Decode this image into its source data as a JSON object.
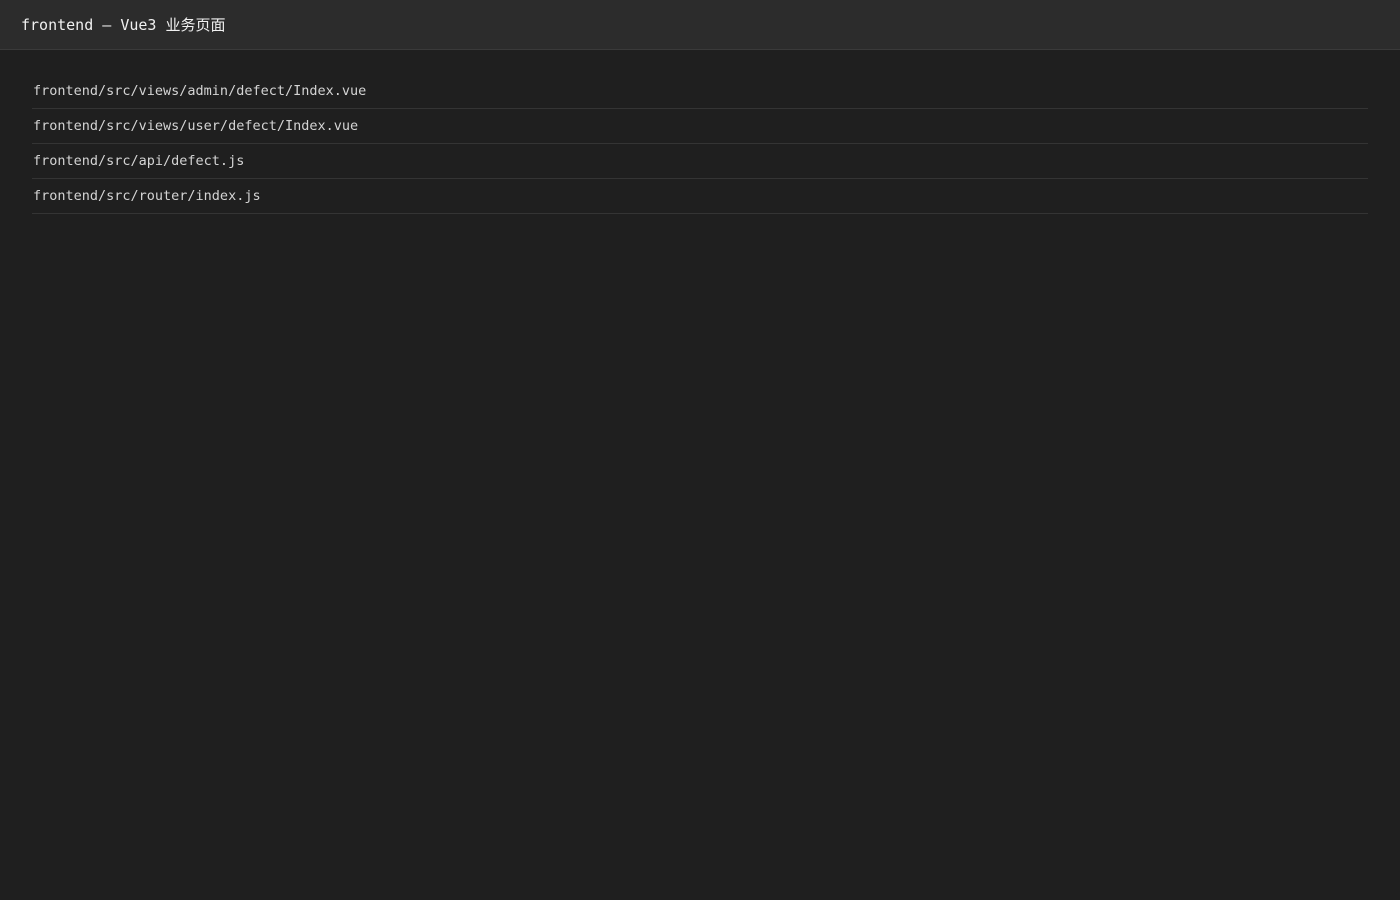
{
  "header": {
    "title": "frontend — Vue3 业务页面"
  },
  "files": [
    {
      "path": "frontend/src/views/admin/defect/Index.vue"
    },
    {
      "path": "frontend/src/views/user/defect/Index.vue"
    },
    {
      "path": "frontend/src/api/defect.js"
    },
    {
      "path": "frontend/src/router/index.js"
    }
  ],
  "colors": {
    "background": "#1f1f1f",
    "header_background": "#2c2c2c",
    "text": "#d4d4d4",
    "divider": "#343434"
  }
}
